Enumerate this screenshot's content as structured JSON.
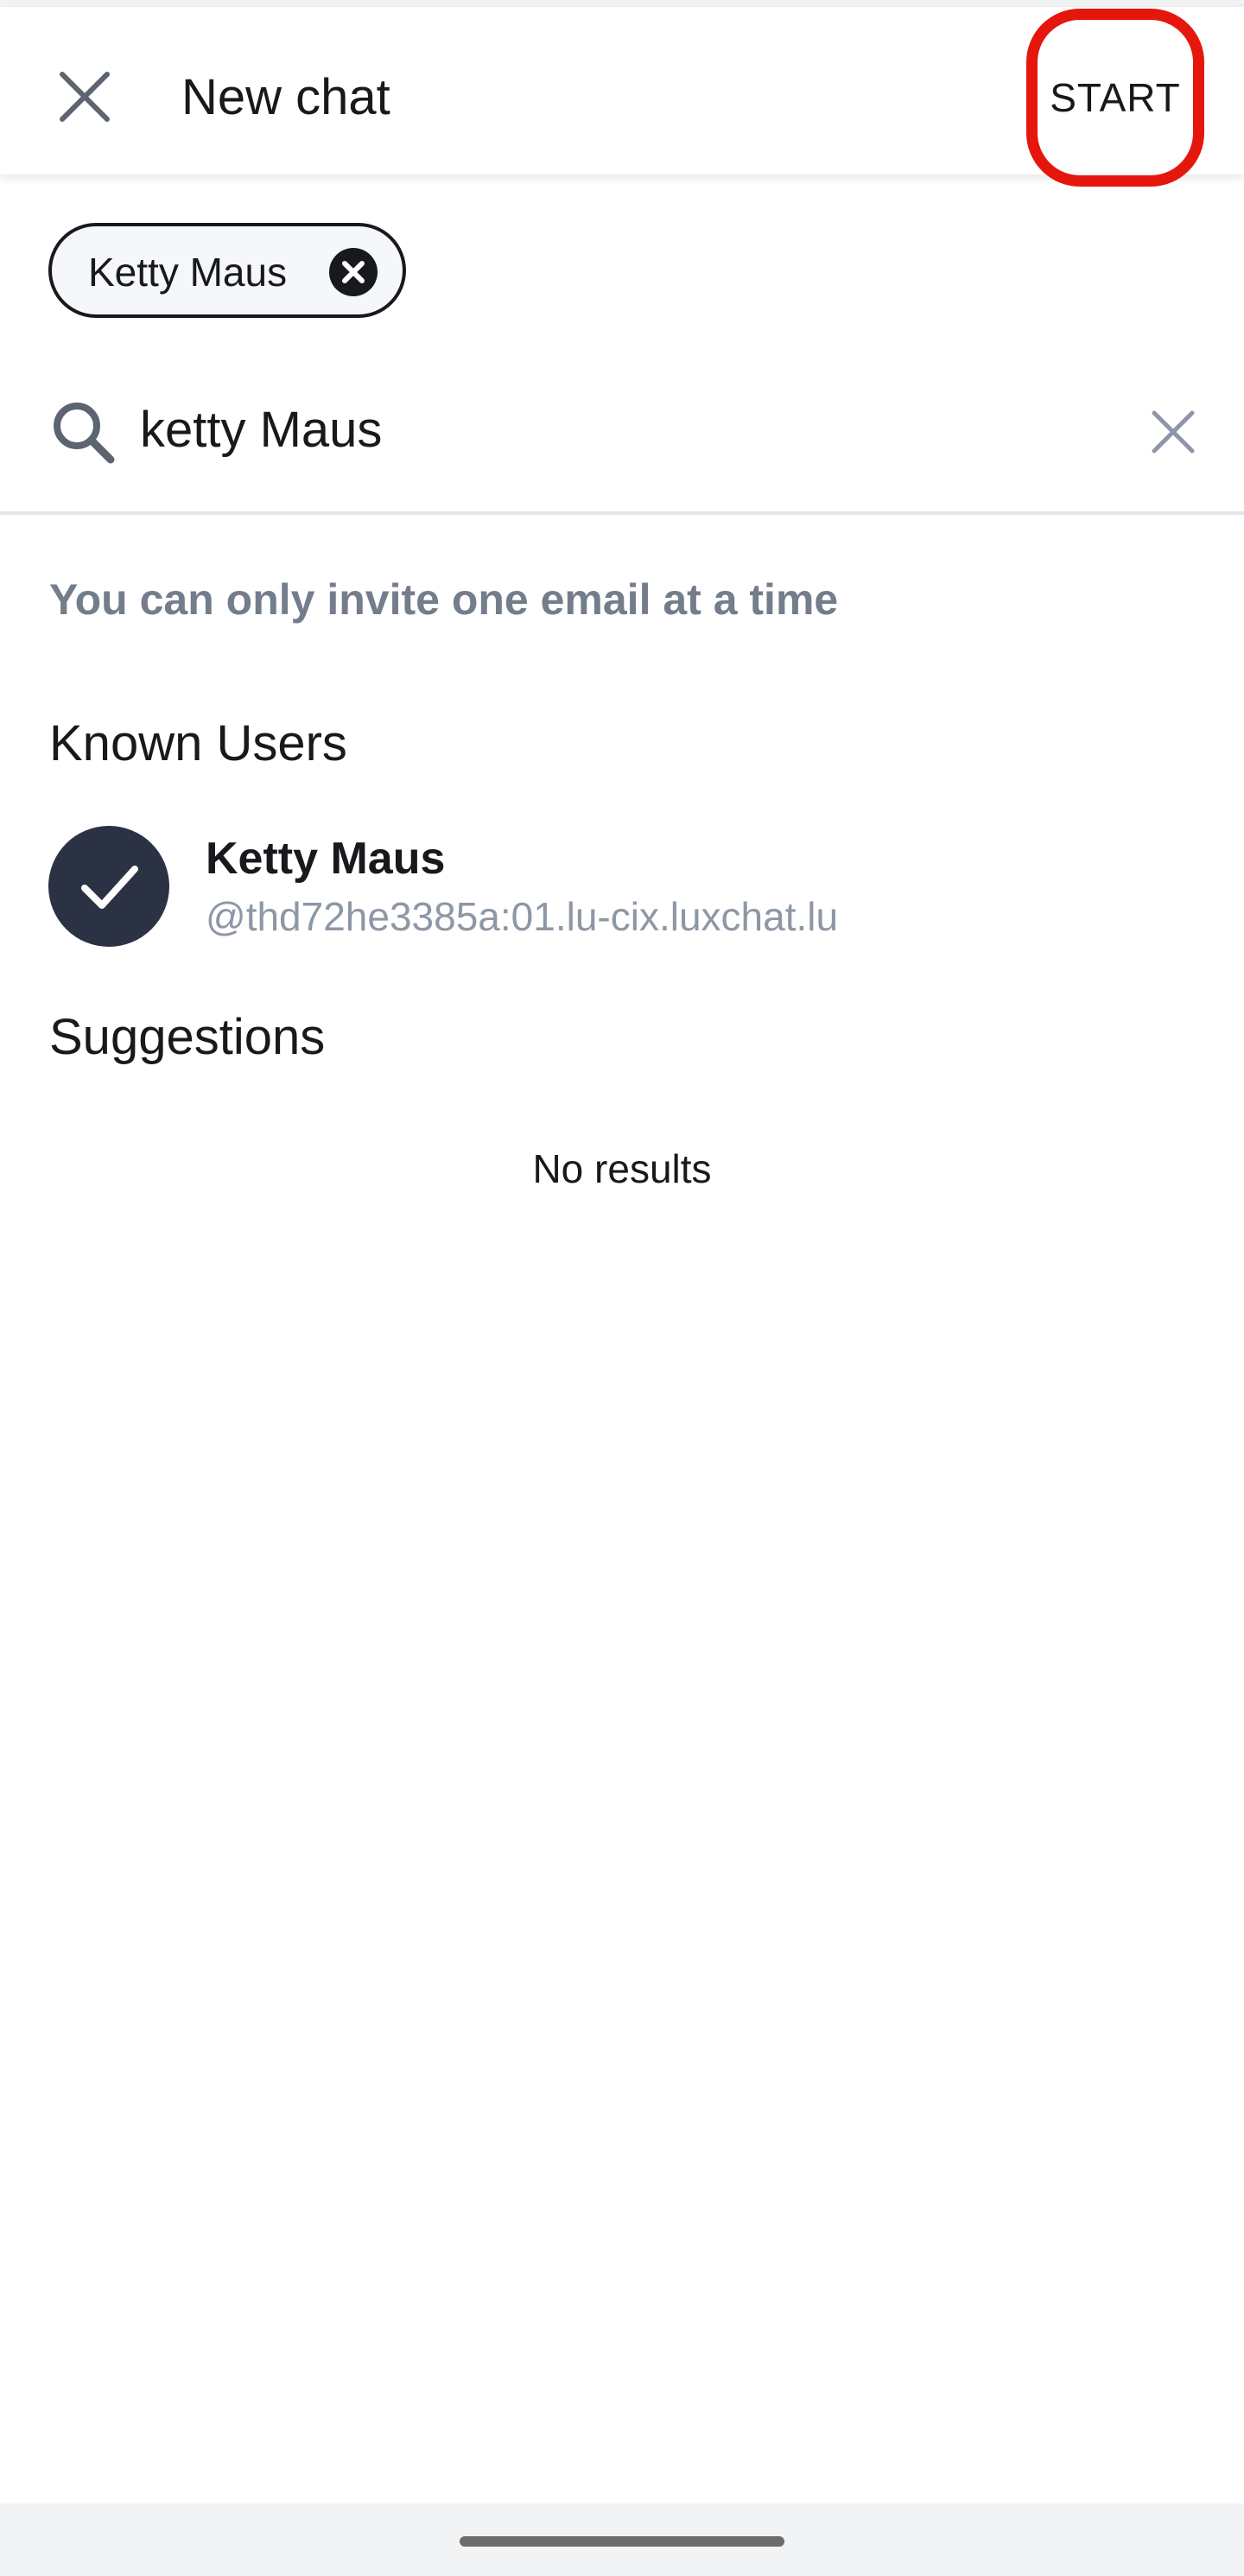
{
  "header": {
    "title": "New chat",
    "start_label": "START",
    "close_icon": "close-icon"
  },
  "selected_chip": {
    "label": "Ketty Maus",
    "remove_icon": "remove-circle-icon"
  },
  "search": {
    "value": "ketty Maus",
    "search_icon": "search-icon",
    "clear_icon": "clear-icon"
  },
  "info_text": "You can only invite one email at a time",
  "known_users": {
    "heading": "Known Users",
    "items": [
      {
        "name": "Ketty Maus",
        "user_id": "@thd72he3385a:01.lu-cix.luxchat.lu",
        "selected": true
      }
    ]
  },
  "suggestions": {
    "heading": "Suggestions",
    "empty_text": "No results"
  },
  "colors": {
    "accent_highlight": "#e5170d",
    "avatar_bg": "#2b3244",
    "muted_text": "#737d8c"
  }
}
